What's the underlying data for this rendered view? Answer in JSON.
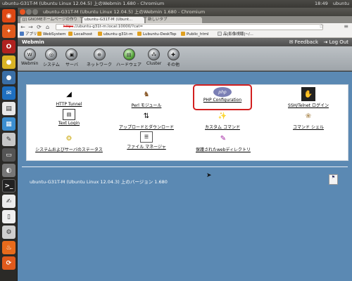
{
  "top_panel": {
    "title": "ubuntu-G31T-M (Ubuntu Linux 12.04.5) 上のWebmin 1.680 - Chromium",
    "tray": [
      "18:49",
      "ubuntu"
    ]
  },
  "window": {
    "title": "ubuntu-G31T-M (Ubuntu Linux 12.04.5) 上のWebmin 1.680 - Chromium"
  },
  "tabs": [
    {
      "label": "[J] GNOMEホームページの作り"
    },
    {
      "label": "ubuntu-G31T-M (Ubunt..."
    },
    {
      "label": "新しいタブ"
    }
  ],
  "address": {
    "scheme": "https",
    "rest": "://ubuntu-g31t-m.local:10000/?cat="
  },
  "bookmarks": [
    "アプリ",
    "WebSystem",
    "Localhost",
    "ubuntu-g31t-m",
    "Lubuntu-DeskTop",
    "Public_html",
    "品|影像視聴|~/..."
  ],
  "webmin": {
    "title": "Webmin",
    "feedback": "Feedback",
    "logout": "Log Out",
    "categories": [
      "Webmin",
      "システム",
      "サーバ",
      "ネットワーク",
      "ハードウェア",
      "Cluster",
      "その他"
    ],
    "modules": [
      {
        "label": "HTTP Tunnel",
        "icon": "tunnel-icon"
      },
      {
        "label": "Perl モジュール",
        "icon": "camel-icon"
      },
      {
        "label": "PHP Configuration",
        "icon": "php-icon"
      },
      {
        "label": "SSH/Telnet ログイン",
        "icon": "terminal-hand-icon"
      },
      {
        "label": "Text Login",
        "icon": "text-login-icon"
      },
      {
        "label": "アップロードとダウンロード",
        "icon": "upload-download-icon"
      },
      {
        "label": "カスタム コマンド",
        "icon": "wand-icon"
      },
      {
        "label": "コマンド シェル",
        "icon": "shell-icon"
      },
      {
        "label": "システムおよびサーバのステータス",
        "icon": "status-icon"
      },
      {
        "label": "ファイル マネージャ",
        "icon": "file-manager-icon"
      },
      {
        "label": "保護されたwebディレクトリ",
        "icon": "protected-dir-icon"
      }
    ],
    "version": "ubuntu-G31T-M (Ubuntu Linux 12.04.3) 上のバージョン 1.680"
  },
  "colors": {
    "main_bg": "#5b89b3",
    "selection_outline": "#d21f1f"
  }
}
